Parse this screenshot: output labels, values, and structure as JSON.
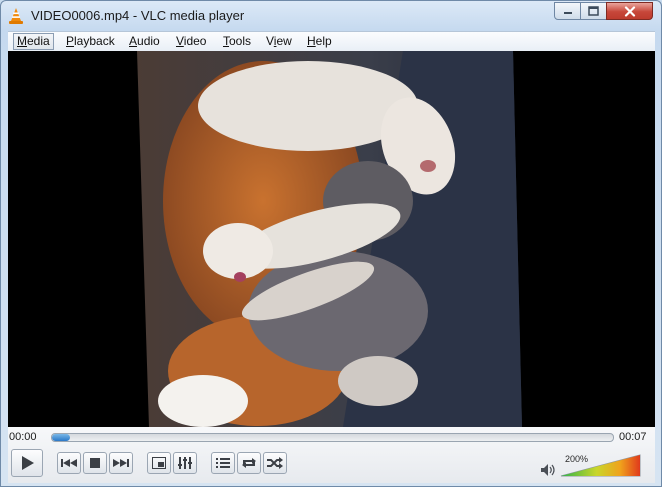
{
  "window": {
    "title": "VIDEO0006.mp4 - VLC media player"
  },
  "menu": {
    "items": [
      {
        "pre": "",
        "key": "M",
        "post": "edia"
      },
      {
        "pre": "",
        "key": "P",
        "post": "layback"
      },
      {
        "pre": "",
        "key": "A",
        "post": "udio"
      },
      {
        "pre": "",
        "key": "V",
        "post": "ideo"
      },
      {
        "pre": "",
        "key": "T",
        "post": "ools"
      },
      {
        "pre": "V",
        "key": "i",
        "post": "ew"
      },
      {
        "pre": "",
        "key": "H",
        "post": "elp"
      }
    ]
  },
  "player": {
    "elapsed": "00:00",
    "duration": "00:07",
    "progress_fraction": 0.03,
    "volume_label": "200%",
    "volume_fraction": 1.0
  },
  "colors": {
    "accent": "#2a78c8",
    "volume_low": "#2db34a",
    "volume_high": "#e03a1c"
  },
  "icons": [
    "vlc-cone-icon",
    "minimize-icon",
    "maximize-icon",
    "close-icon",
    "play-icon",
    "previous-icon",
    "stop-icon",
    "next-icon",
    "fullscreen-icon",
    "extended-settings-icon",
    "playlist-icon",
    "loop-icon",
    "shuffle-icon",
    "speaker-icon"
  ]
}
